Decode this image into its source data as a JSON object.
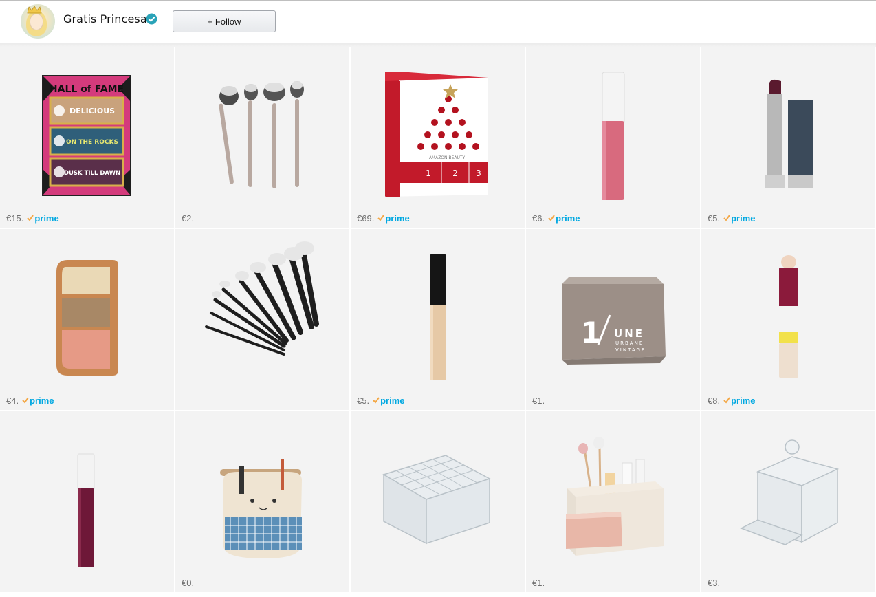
{
  "profile": {
    "name": "Gratis Princesa",
    "verified": true
  },
  "follow_button": {
    "label": "+ Follow"
  },
  "prime_label": "prime",
  "products": [
    {
      "art": "w7-hall-of-fame-palette",
      "price": "€15.",
      "prime": true,
      "texts": [
        "HALL of FAME",
        "DELICIOUS",
        "ON THE ROCKS",
        "DUSK TILL DAWN"
      ]
    },
    {
      "art": "makeup-brush-set-4",
      "price": "€2.",
      "prime": false
    },
    {
      "art": "amazon-beauty-advent-calendar",
      "price": "€69.",
      "prime": true,
      "texts": [
        "AMAZON BEAUTY",
        "1",
        "2",
        "3"
      ]
    },
    {
      "art": "pink-liquid-lipstick",
      "price": "€6.",
      "prime": true
    },
    {
      "art": "dark-plum-lipstick",
      "price": "€5.",
      "prime": true
    },
    {
      "art": "contour-palette",
      "price": "€4.",
      "prime": true
    },
    {
      "art": "black-brush-set",
      "price": "",
      "prime": false
    },
    {
      "art": "fit-me-concealer",
      "price": "€5.",
      "prime": true
    },
    {
      "art": "linen-storage-basket",
      "price": "€1.",
      "prime": false,
      "texts": [
        "1",
        "UNE",
        "URBANE",
        "VINTAGE"
      ]
    },
    {
      "art": "instant-anti-age-concealer",
      "price": "€8.",
      "prime": true
    },
    {
      "art": "burgundy-liquid-lipstick",
      "price": "",
      "prime": false
    },
    {
      "art": "cat-hanging-basket",
      "price": "€0.",
      "prime": false
    },
    {
      "art": "acrylic-lipstick-organizer",
      "price": "",
      "prime": false
    },
    {
      "art": "desk-cosmetic-organizer",
      "price": "€1.",
      "prime": false
    },
    {
      "art": "cotton-pad-holder",
      "price": "€3.",
      "prime": false
    }
  ]
}
